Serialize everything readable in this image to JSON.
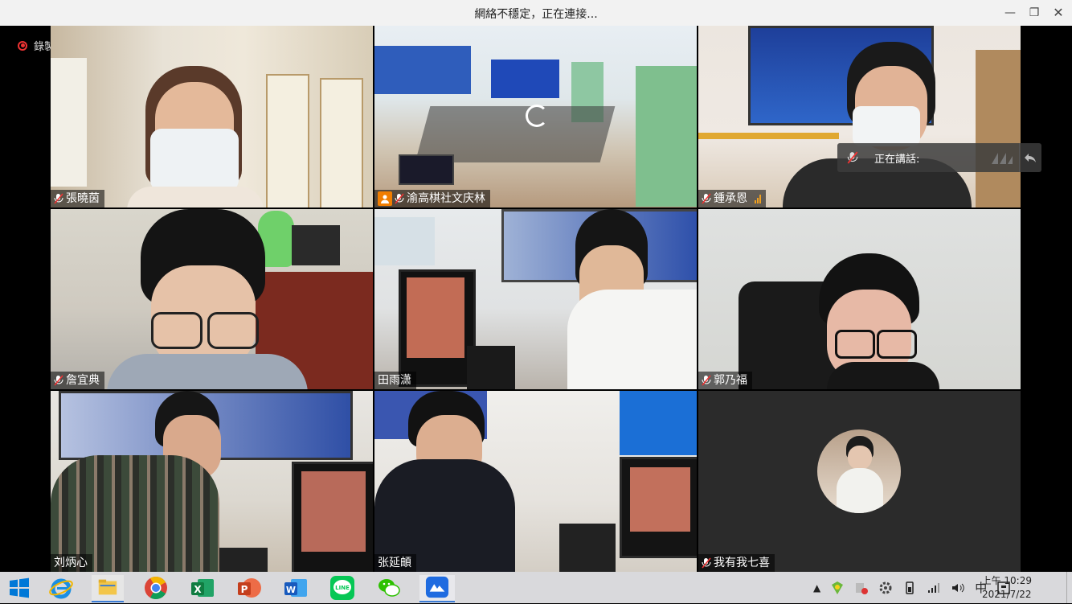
{
  "window": {
    "title": "網絡不穩定，正在連接..."
  },
  "recording": {
    "label": "錄製中"
  },
  "speaking": {
    "label": "正在講話:"
  },
  "participants": [
    {
      "name": "張曉茵"
    },
    {
      "name": "渝高棋社文庆林"
    },
    {
      "name": "鍾承恩"
    },
    {
      "name": "詹宜典"
    },
    {
      "name": "田雨潇"
    },
    {
      "name": "郭乃福"
    },
    {
      "name": "刘炳心"
    },
    {
      "name": "张延頔"
    },
    {
      "name": "我有我七喜"
    }
  ],
  "taskbar": {
    "apps": [
      "windows-start",
      "internet-explorer",
      "file-explorer",
      "chrome",
      "excel",
      "powerpoint",
      "word",
      "line",
      "wechat",
      "meeting-app"
    ],
    "tray": {
      "ime": "中"
    },
    "clock": {
      "time": "上午 10:29",
      "date": "2021/7/22"
    }
  },
  "colors": {
    "accent": "#f07d00",
    "recording": "#e33333",
    "speaker_panel": "#3c3c3c"
  }
}
